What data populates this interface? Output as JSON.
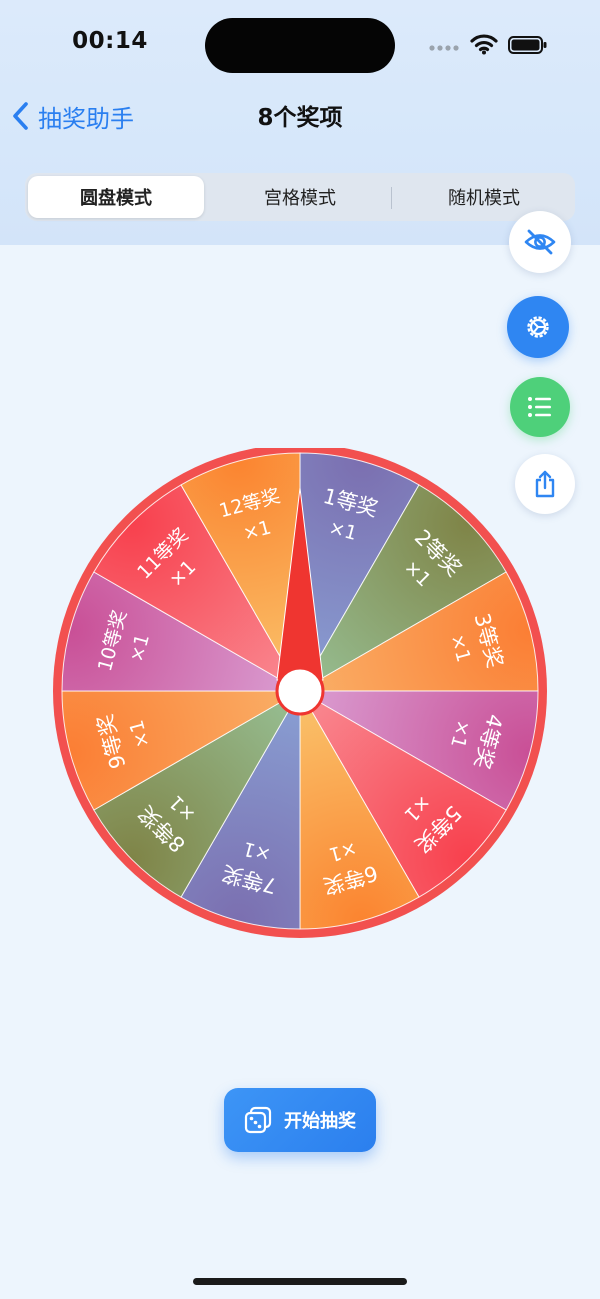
{
  "status": {
    "time": "00:14"
  },
  "nav": {
    "back_label": "抽奖助手",
    "title": "8个奖项"
  },
  "modes": [
    {
      "label": "圆盘模式",
      "active": true
    },
    {
      "label": "宫格模式",
      "active": false
    },
    {
      "label": "随机模式",
      "active": false
    }
  ],
  "fabs": [
    {
      "name": "eye-slash-icon",
      "color": "#2f86f2"
    },
    {
      "name": "gear-icon",
      "color": "#ffffff"
    },
    {
      "name": "list-icon",
      "color": "#ffffff"
    },
    {
      "name": "share-icon",
      "color": "#2f86f2"
    }
  ],
  "wheel": {
    "rim_color": "#f2504f",
    "prizes": [
      {
        "name": "1等奖",
        "count": "×1",
        "from": "#7b6fb0",
        "to": "#8aa3d6"
      },
      {
        "name": "2等奖",
        "count": "×1",
        "from": "#7f8447",
        "to": "#99c49a"
      },
      {
        "name": "3等奖",
        "count": "×1",
        "from": "#fb7e34",
        "to": "#f9b36b"
      },
      {
        "name": "4等奖",
        "count": "×1",
        "from": "#c94f96",
        "to": "#dba3d6"
      },
      {
        "name": "5等奖",
        "count": "×1",
        "from": "#f8404d",
        "to": "#f99098"
      },
      {
        "name": "6等奖",
        "count": "×1",
        "from": "#fb8430",
        "to": "#f9c870"
      },
      {
        "name": "7等奖",
        "count": "×1",
        "from": "#7b6fb0",
        "to": "#8aa3d6"
      },
      {
        "name": "8等奖",
        "count": "×1",
        "from": "#7f8447",
        "to": "#99c49a"
      },
      {
        "name": "9等奖",
        "count": "×1",
        "from": "#fb7e34",
        "to": "#f9b36b"
      },
      {
        "name": "10等奖",
        "count": "×1",
        "from": "#c94f96",
        "to": "#dba3d6"
      },
      {
        "name": "11等奖",
        "count": "×1",
        "from": "#f8404d",
        "to": "#f99098"
      },
      {
        "name": "12等奖",
        "count": "×1",
        "from": "#fb8430",
        "to": "#f9c870"
      }
    ],
    "pointer_color": "#ef3530"
  },
  "start_button": {
    "label": "开始抽奖"
  }
}
